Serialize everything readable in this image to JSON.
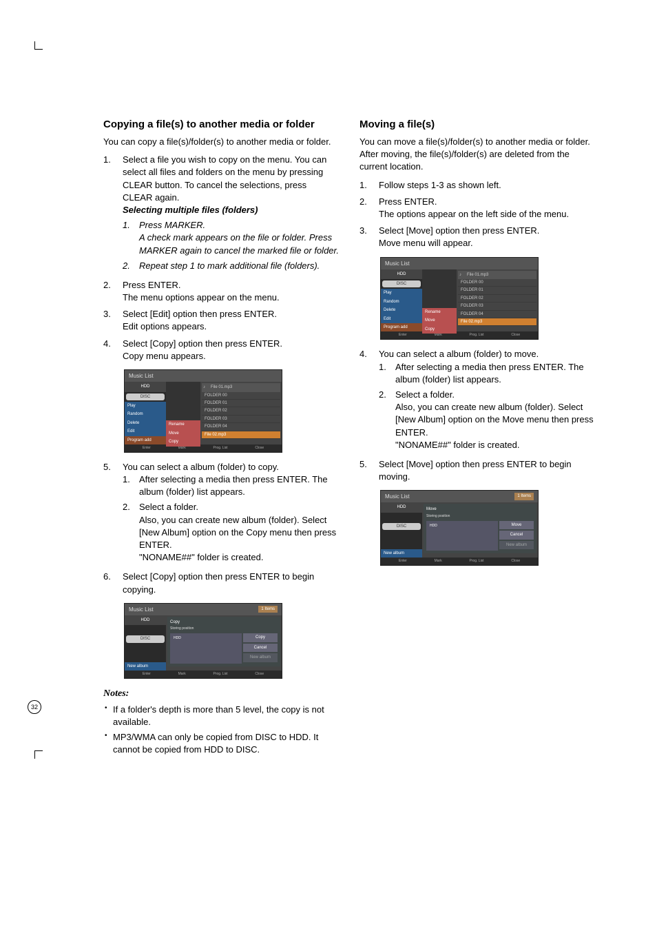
{
  "page_number": "32",
  "left": {
    "title": "Copying a file(s) to another media or folder",
    "intro": "You can copy a file(s)/folder(s) to another media or folder.",
    "steps": [
      {
        "num": "1.",
        "text": "Select a file you wish to copy on the menu. You can select all files and folders on the menu by pressing CLEAR button. To cancel the selections, press CLEAR again.",
        "sub_heading": "Selecting multiple files (folders)",
        "sub_steps": [
          {
            "num": "1.",
            "text": "Press MARKER.\nA check mark appears on the file or folder. Press MARKER again to cancel the marked file or folder."
          },
          {
            "num": "2.",
            "text": "Repeat step 1 to mark additional file (folders)."
          }
        ]
      },
      {
        "num": "2.",
        "text": "Press ENTER.\nThe menu options appear on the menu."
      },
      {
        "num": "3.",
        "text": "Select [Edit] option then press ENTER.\nEdit options appears."
      },
      {
        "num": "4.",
        "text": "Select [Copy] option then press ENTER.\nCopy menu appears."
      }
    ],
    "step5": {
      "num": "5.",
      "text": "You can select a album (folder) to copy.",
      "sub_steps": [
        {
          "num": "1.",
          "text": "After selecting a media then press ENTER. The album (folder) list appears."
        },
        {
          "num": "2.",
          "text": "Select a folder.\nAlso, you can create new album (folder). Select [New Album] option on the Copy menu then press ENTER.\n\"NONAME##\" folder is created."
        }
      ]
    },
    "step6": {
      "num": "6.",
      "text": "Select [Copy] option then press ENTER to begin copying."
    },
    "notes_heading": "Notes:",
    "notes": [
      "If a folder's depth is more than 5 level, the copy is not available.",
      "MP3/WMA can only be copied from DISC to HDD. It cannot be copied from HDD to DISC."
    ]
  },
  "right": {
    "title": "Moving a file(s)",
    "intro": "You can move a file(s)/folder(s) to another media or folder. After moving, the file(s)/folder(s) are deleted from the current location.",
    "steps": [
      {
        "num": "1.",
        "text": "Follow steps 1-3 as shown left."
      },
      {
        "num": "2.",
        "text": "Press ENTER.\nThe options appear on the left side of the menu."
      },
      {
        "num": "3.",
        "text": "Select [Move] option then press ENTER.\nMove menu will appear."
      }
    ],
    "step4": {
      "num": "4.",
      "text": "You can select a album (folder) to move.",
      "sub_steps": [
        {
          "num": "1.",
          "text": "After selecting a media then press ENTER. The album (folder) list appears."
        },
        {
          "num": "2.",
          "text": "Select a folder.\nAlso, you can create new album (folder). Select [New Album] option on the Move menu then press ENTER.\n\"NONAME##\" folder is created."
        }
      ]
    },
    "step5": {
      "num": "5.",
      "text": "Select [Move] option then press ENTER to begin moving."
    }
  },
  "screenshots": {
    "s1": {
      "title": "Music List",
      "header_file": "File 01.mp3",
      "sidebar": {
        "hdd": "HDD",
        "disc": "DISC",
        "play": "Play",
        "random": "Random",
        "delete": "Delete",
        "edit": "Edit",
        "program": "Program add",
        "rename": "Rename",
        "move": "Move",
        "copy": "Copy"
      },
      "folders": [
        "FOLDER 00",
        "FOLDER 01",
        "FOLDER 02",
        "FOLDER 03",
        "FOLDER 04"
      ],
      "file_highlight": "File 02.mp3",
      "footer": {
        "enter": "Enter",
        "mark": "Mark",
        "prog": "Prog. List",
        "close": "Close"
      }
    },
    "s2": {
      "title": "Music List",
      "items": "1 Items",
      "panel_title": "Copy",
      "panel_sub": "Storing position",
      "hdd": "HDD",
      "sidebar": {
        "hdd": "HDD",
        "disc": "DISC",
        "new": "New album"
      },
      "buttons": {
        "copy": "Copy",
        "cancel": "Cancel",
        "newalbum": "New album"
      },
      "footer": {
        "enter": "Enter",
        "mark": "Mark",
        "prog": "Prog. List",
        "close": "Close"
      }
    },
    "s3": {
      "title": "Music List",
      "header_file": "File 01.mp3",
      "sidebar": {
        "hdd": "HDD",
        "disc": "DISC",
        "play": "Play",
        "random": "Random",
        "delete": "Delete",
        "edit": "Edit",
        "program": "Program add",
        "rename": "Rename",
        "move": "Move",
        "copy": "Copy"
      },
      "folders": [
        "FOLDER 00",
        "FOLDER 01",
        "FOLDER 02",
        "FOLDER 03",
        "FOLDER 04"
      ],
      "file_highlight": "File 02.mp3",
      "footer": {
        "enter": "Enter",
        "mark": "Mark",
        "prog": "Prog. List",
        "close": "Close"
      }
    },
    "s4": {
      "title": "Music List",
      "items": "1 Items",
      "panel_title": "Move",
      "panel_sub": "Storing position",
      "hdd": "HDD",
      "sidebar": {
        "hdd": "HDD",
        "disc": "DISC",
        "new": "New album"
      },
      "buttons": {
        "move": "Move",
        "cancel": "Cancel",
        "newalbum": "New album"
      },
      "footer": {
        "enter": "Enter",
        "mark": "Mark",
        "prog": "Prog. List",
        "close": "Close"
      }
    }
  }
}
